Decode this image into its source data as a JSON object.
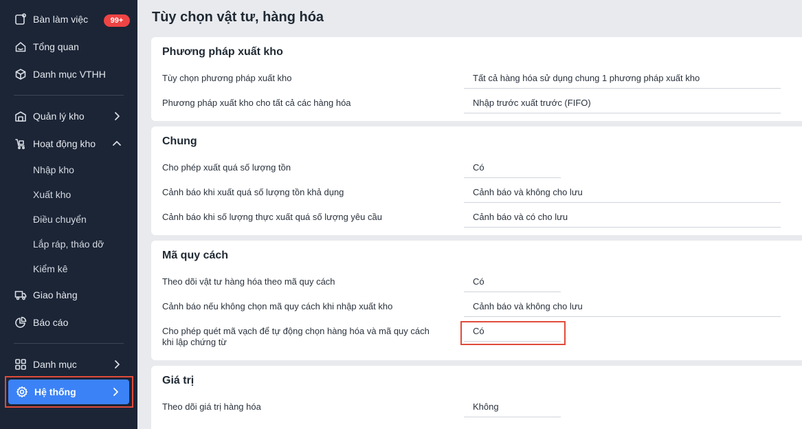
{
  "sidebar": {
    "badge": "99+",
    "items": [
      {
        "label": "Bàn làm việc"
      },
      {
        "label": "Tổng quan"
      },
      {
        "label": "Danh mục VTHH"
      },
      {
        "label": "Quản lý kho"
      },
      {
        "label": "Hoạt động kho"
      },
      {
        "label": "Giao hàng"
      },
      {
        "label": "Báo cáo"
      },
      {
        "label": "Danh mục"
      },
      {
        "label": "Hệ thống"
      }
    ],
    "subitems": [
      "Nhập kho",
      "Xuất kho",
      "Điều chuyển",
      "Lắp ráp, tháo dỡ",
      "Kiểm kê"
    ],
    "active_color": "#3b82f6"
  },
  "page_title": "Tùy chọn vật tư, hàng hóa",
  "sections": [
    {
      "title": "Phương pháp xuất kho",
      "rows": [
        {
          "label": "Tùy chọn phương pháp xuất kho",
          "value": "Tất cả hàng hóa sử dụng chung 1 phương pháp xuất kho"
        },
        {
          "label": "Phương pháp xuất kho cho tất cả các hàng hóa",
          "value": "Nhập trước xuất trước (FIFO)"
        }
      ]
    },
    {
      "title": "Chung",
      "rows": [
        {
          "label": "Cho phép xuất quá số lượng tồn",
          "value": "Có"
        },
        {
          "label": "Cảnh báo khi xuất quá số lượng tồn khả dụng",
          "value": "Cảnh báo và không cho lưu"
        },
        {
          "label": "Cảnh báo khi số lượng thực xuất quá số lượng yêu cầu",
          "value": "Cảnh báo và có cho lưu"
        }
      ]
    },
    {
      "title": "Mã quy cách",
      "rows": [
        {
          "label": "Theo dõi vật tư hàng hóa theo mã quy cách",
          "value": "Có"
        },
        {
          "label": "Cảnh báo nếu không chọn mã quy cách khi nhập xuất kho",
          "value": "Cảnh báo và không cho lưu"
        },
        {
          "label": "Cho phép quét mã vạch để tự động chọn hàng hóa và mã quy cách khi lập chứng từ",
          "value": "Có"
        }
      ]
    },
    {
      "title": "Giá trị",
      "rows": [
        {
          "label": "Theo dõi giá trị hàng hóa",
          "value": "Không"
        }
      ]
    }
  ],
  "highlight_color": "#e04a3a"
}
